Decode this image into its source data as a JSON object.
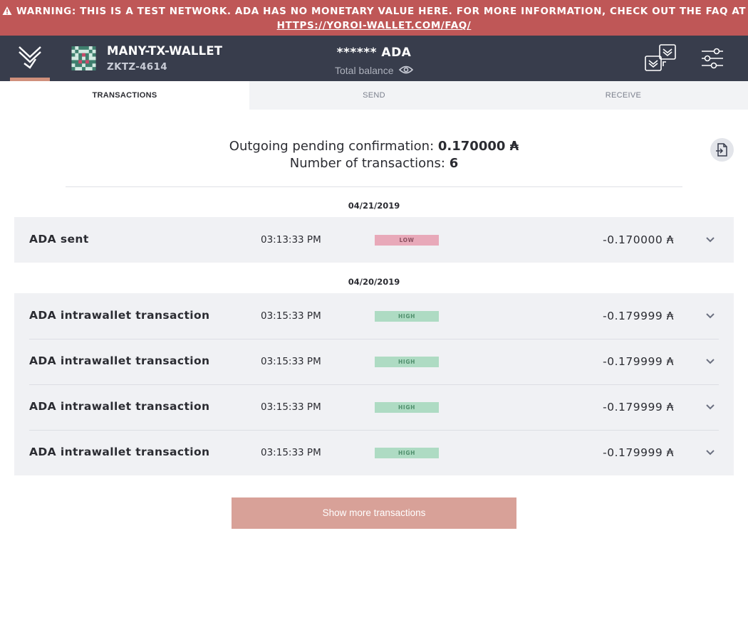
{
  "warning": {
    "text": "WARNING: THIS IS A TEST NETWORK. ADA HAS NO MONETARY VALUE HERE. FOR MORE INFORMATION, CHECK OUT THE FAQ AT",
    "link": "HTTPS://YOROI-WALLET.COM/FAQ/"
  },
  "header": {
    "wallet_name": "MANY-TX-WALLET",
    "wallet_plate": "ZKTZ-4614",
    "balance": "****** ADA",
    "balance_label": "Total balance"
  },
  "tabs": [
    {
      "label": "TRANSACTIONS"
    },
    {
      "label": "SEND"
    },
    {
      "label": "RECEIVE"
    }
  ],
  "summary": {
    "pending_label": "Outgoing pending confirmation:",
    "pending_value": "0.170000 ₳",
    "count_label": "Number of transactions:",
    "count_value": "6"
  },
  "groups": [
    {
      "date": "04/21/2019",
      "rows": [
        {
          "type": "ADA sent",
          "time": "03:13:33 PM",
          "badge": "LOW",
          "amount": "-0.170000 ₳"
        }
      ]
    },
    {
      "date": "04/20/2019",
      "rows": [
        {
          "type": "ADA intrawallet transaction",
          "time": "03:15:33 PM",
          "badge": "HIGH",
          "amount": "-0.179999 ₳"
        },
        {
          "type": "ADA intrawallet transaction",
          "time": "03:15:33 PM",
          "badge": "HIGH",
          "amount": "-0.179999 ₳"
        },
        {
          "type": "ADA intrawallet transaction",
          "time": "03:15:33 PM",
          "badge": "HIGH",
          "amount": "-0.179999 ₳"
        },
        {
          "type": "ADA intrawallet transaction",
          "time": "03:15:33 PM",
          "badge": "HIGH",
          "amount": "-0.179999 ₳"
        }
      ]
    }
  ],
  "show_more_label": "Show more transactions",
  "colors": {
    "warning_bg": "#bf5757",
    "header_bg": "#383d4c",
    "low_badge": "#e8a9b9",
    "high_badge": "#aedbc3",
    "show_more_bg": "#d8a198"
  }
}
